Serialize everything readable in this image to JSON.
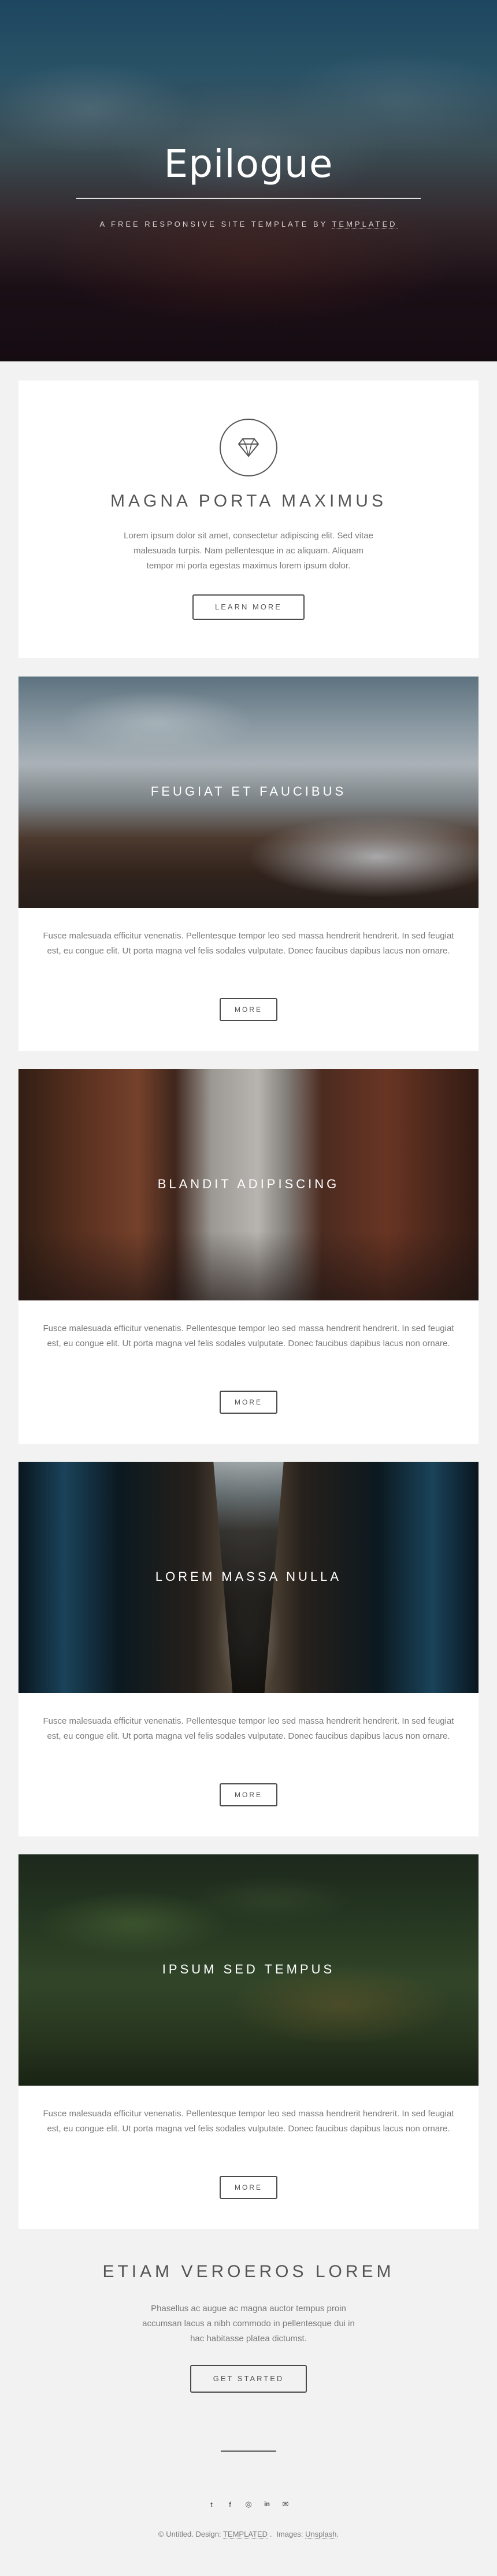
{
  "header": {
    "title": "Epilogue",
    "tagline_prefix": "A FREE RESPONSIVE SITE TEMPLATE BY",
    "tagline_link": "TEMPLATED"
  },
  "intro": {
    "icon": "diamond-icon",
    "title": "MAGNA PORTA MAXIMUS",
    "text": "Lorem ipsum dolor sit amet, consectetur adipiscing elit. Sed vitae malesuada turpis. Nam pellentesque in ac aliquam. Aliquam tempor mi porta egestas maximus lorem ipsum dolor.",
    "button_label": "LEARN MORE"
  },
  "posts": [
    {
      "title": "FEUGIAT ET FAUCIBUS",
      "text": "Fusce malesuada efficitur venenatis. Pellentesque tempor leo sed massa hendrerit hendrerit. In sed feugiat est, eu congue elit. Ut porta magna vel felis sodales vulputate. Donec faucibus dapibus lacus non ornare.",
      "button_label": "MORE"
    },
    {
      "title": "BLANDIT ADIPISCING",
      "text": "Fusce malesuada efficitur venenatis. Pellentesque tempor leo sed massa hendrerit hendrerit. In sed feugiat est, eu congue elit. Ut porta magna vel felis sodales vulputate. Donec faucibus dapibus lacus non ornare.",
      "button_label": "MORE"
    },
    {
      "title": "LOREM MASSA NULLA",
      "text": "Fusce malesuada efficitur venenatis. Pellentesque tempor leo sed massa hendrerit hendrerit. In sed feugiat est, eu congue elit. Ut porta magna vel felis sodales vulputate. Donec faucibus dapibus lacus non ornare.",
      "button_label": "MORE"
    },
    {
      "title": "IPSUM SED TEMPUS",
      "text": "Fusce malesuada efficitur venenatis. Pellentesque tempor leo sed massa hendrerit hendrerit. In sed feugiat est, eu congue elit. Ut porta magna vel felis sodales vulputate. Donec faucibus dapibus lacus non ornare.",
      "button_label": "MORE"
    }
  ],
  "cta": {
    "title": "ETIAM VEROEROS LOREM",
    "text": "Phasellus ac augue ac magna auctor tempus proin accumsan lacus a nibh commodo in pellentesque dui in hac habitasse platea dictumst.",
    "button_label": "GET STARTED"
  },
  "footer": {
    "social": [
      {
        "name": "twitter-icon",
        "glyph": "t"
      },
      {
        "name": "facebook-icon",
        "glyph": "f"
      },
      {
        "name": "instagram-icon",
        "glyph": "◎"
      },
      {
        "name": "linkedin-icon",
        "glyph": "in"
      },
      {
        "name": "email-icon",
        "glyph": "✉"
      }
    ],
    "copyright": "© Untitled.",
    "design_label": "Design:",
    "design_link": "TEMPLATED",
    "images_label": "Images:",
    "images_link": "Unsplash"
  },
  "colors": {
    "page_background": "#f2f2f2",
    "box_background": "#ffffff",
    "heading_text": "#555555",
    "body_text": "#7a7a7a"
  }
}
